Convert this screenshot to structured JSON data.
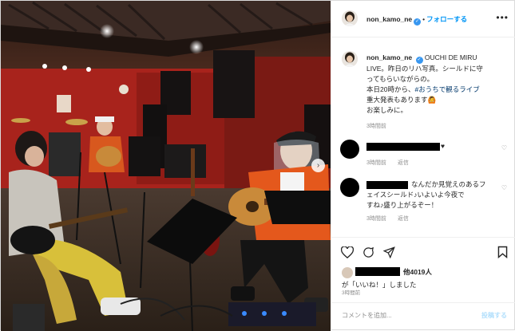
{
  "header": {
    "username": "non_kamo_ne",
    "separator": "•",
    "follow_label": "フォローする",
    "more_label": "•••",
    "verified_mark": "✓"
  },
  "caption": {
    "username": "non_kamo_ne",
    "lines": [
      "OUCHI DE MIRU",
      "LIVE。昨日のリハ写真。シールドに守",
      "ってもらいながらの。",
      "本日20時から、",
      "重大発表もあります",
      "お楽しみに。"
    ],
    "hashtag": "#おうちで観るライブ",
    "emoji": "🙆",
    "time": "3時間前"
  },
  "comments": [
    {
      "text": "♥",
      "time": "3時間前",
      "reply_label": "返信"
    },
    {
      "text_lines": [
        "なんだか見覚えのあるフ",
        "ェイスシールド♪いよいよ今夜で",
        "すね♪盛り上がるぞー！"
      ],
      "time": "3時間前",
      "reply_label": "返信"
    }
  ],
  "likes": {
    "others_label": "他4019人",
    "liked_label": "が「いいね！」しました",
    "time": "3時間前"
  },
  "comment_box": {
    "placeholder": "コメントを追加...",
    "post_label": "投稿する"
  },
  "icons": {
    "heart": "heart-icon",
    "comment": "comment-icon",
    "share": "share-icon",
    "save": "bookmark-icon"
  },
  "colors": {
    "accent": "#0095f6",
    "verified": "#3897f0",
    "muted": "#8e8e8e",
    "wall_red": "#a8231c"
  }
}
